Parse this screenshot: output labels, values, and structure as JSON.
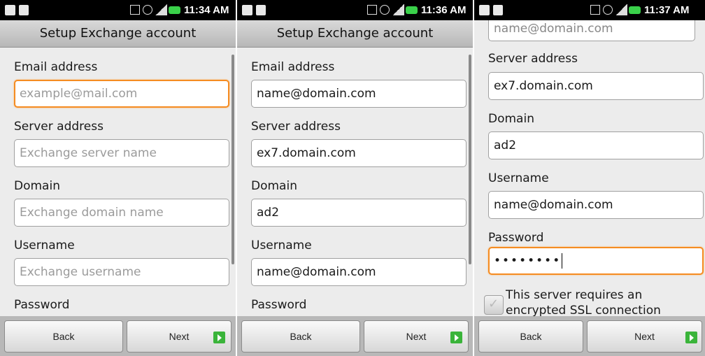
{
  "screens": [
    {
      "time": "11:34 AM",
      "title": "Setup Exchange account",
      "labels": {
        "email": "Email address",
        "server": "Server address",
        "domain": "Domain",
        "username": "Username",
        "password": "Password"
      },
      "placeholders": {
        "email": "example@mail.com",
        "server": "Exchange server name",
        "domain": "Exchange domain name",
        "username": "Exchange username"
      },
      "buttons": {
        "back": "Back",
        "next": "Next"
      }
    },
    {
      "time": "11:36 AM",
      "title": "Setup Exchange account",
      "labels": {
        "email": "Email address",
        "server": "Server address",
        "domain": "Domain",
        "username": "Username",
        "password": "Password"
      },
      "values": {
        "email": "name@domain.com",
        "server": "ex7.domain.com",
        "domain": "ad2",
        "username": "name@domain.com"
      },
      "buttons": {
        "back": "Back",
        "next": "Next"
      }
    },
    {
      "time": "11:37 AM",
      "partial_value": "name@domain.com",
      "labels": {
        "server": "Server address",
        "domain": "Domain",
        "username": "Username",
        "password": "Password"
      },
      "values": {
        "server": "ex7.domain.com",
        "domain": "ad2",
        "username": "name@domain.com",
        "password": "••••••••"
      },
      "ssl": {
        "line1": "This server requires an",
        "line2": "encrypted SSL connection"
      },
      "buttons": {
        "back": "Back",
        "next": "Next"
      }
    }
  ]
}
